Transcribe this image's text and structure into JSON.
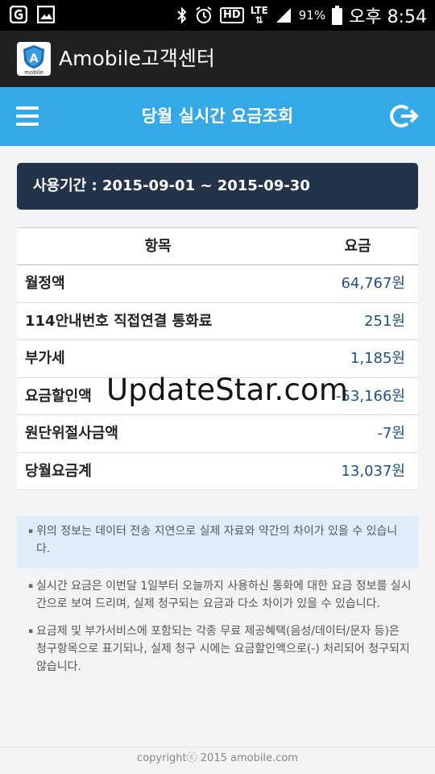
{
  "status_bar": {
    "battery": "91%",
    "time": "오후 8:54",
    "network": "LTE",
    "hd": "HD"
  },
  "app": {
    "title": "Amobile고객센터",
    "logo_label": "mobile",
    "logo_letter": "A"
  },
  "header": {
    "title": "당월 실시간 요금조회"
  },
  "period": {
    "text": "사용기간 : 2015-09-01 ~ 2015-09-30"
  },
  "table": {
    "columns": [
      "항목",
      "요금"
    ],
    "rows": [
      {
        "item": "월정액",
        "fee": "64,767원"
      },
      {
        "item": "114안내번호 직접연결 통화료",
        "fee": "251원"
      },
      {
        "item": "부가세",
        "fee": "1,185원"
      },
      {
        "item": "요금할인액",
        "fee": "-53,166원"
      },
      {
        "item": "원단위절사금액",
        "fee": "-7원"
      },
      {
        "item": "당월요금계",
        "fee": "13,037원"
      }
    ]
  },
  "watermark": "UpdateStar.com",
  "notes": {
    "highlight": "위의 정보는 데이터 전송 지연으로 실제 자료와 약간의 차이가 있을 수 있습니다.",
    "items": [
      "실시간 요금은 이번달 1일부터 오늘까지 사용하신 통화에 대한 요금 정보를 실시간으로 보여 드리며, 실제 청구되는 요금과 다소 차이가 있을 수 있습니다.",
      "요금제 및 부가서비스에 포함되는 각종 무료 제공혜택(음성/데이터/문자 등)은 청구항목으로 표기되나, 실제 청구 시에는 요금할인액으로(-) 처리되어 청구되지 않습니다."
    ]
  },
  "footer": {
    "copyright": "copyrightⓒ 2015 amobile.com"
  },
  "colors": {
    "header_bg": "#35a8e6",
    "period_bg": "#233349",
    "fee_text": "#1e4f86",
    "app_bar_bg": "#212121"
  }
}
